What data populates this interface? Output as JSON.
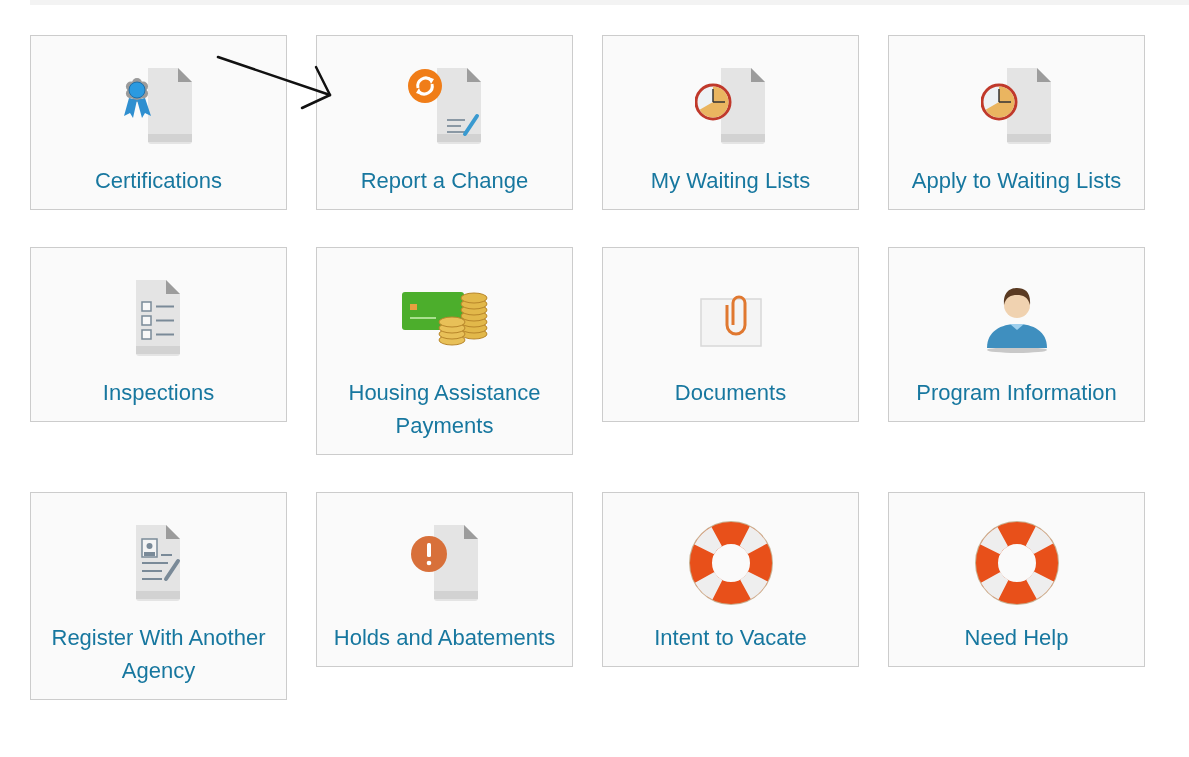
{
  "tiles": [
    {
      "label": "Certifications",
      "kind": "certificate"
    },
    {
      "label": "Report a Change",
      "kind": "change"
    },
    {
      "label": "My Waiting Lists",
      "kind": "clock"
    },
    {
      "label": "Apply to Waiting Lists",
      "kind": "clock"
    },
    {
      "label": "Inspections",
      "kind": "checklist"
    },
    {
      "label": "Housing Assistance Payments",
      "kind": "payment"
    },
    {
      "label": "Documents",
      "kind": "attachment"
    },
    {
      "label": "Program Information",
      "kind": "profile"
    },
    {
      "label": "Register With Another Agency",
      "kind": "registration"
    },
    {
      "label": "Holds and Abatements",
      "kind": "alert"
    },
    {
      "label": "Intent to Vacate",
      "kind": "lifebuoy"
    },
    {
      "label": "Need Help",
      "kind": "lifebuoy"
    }
  ]
}
